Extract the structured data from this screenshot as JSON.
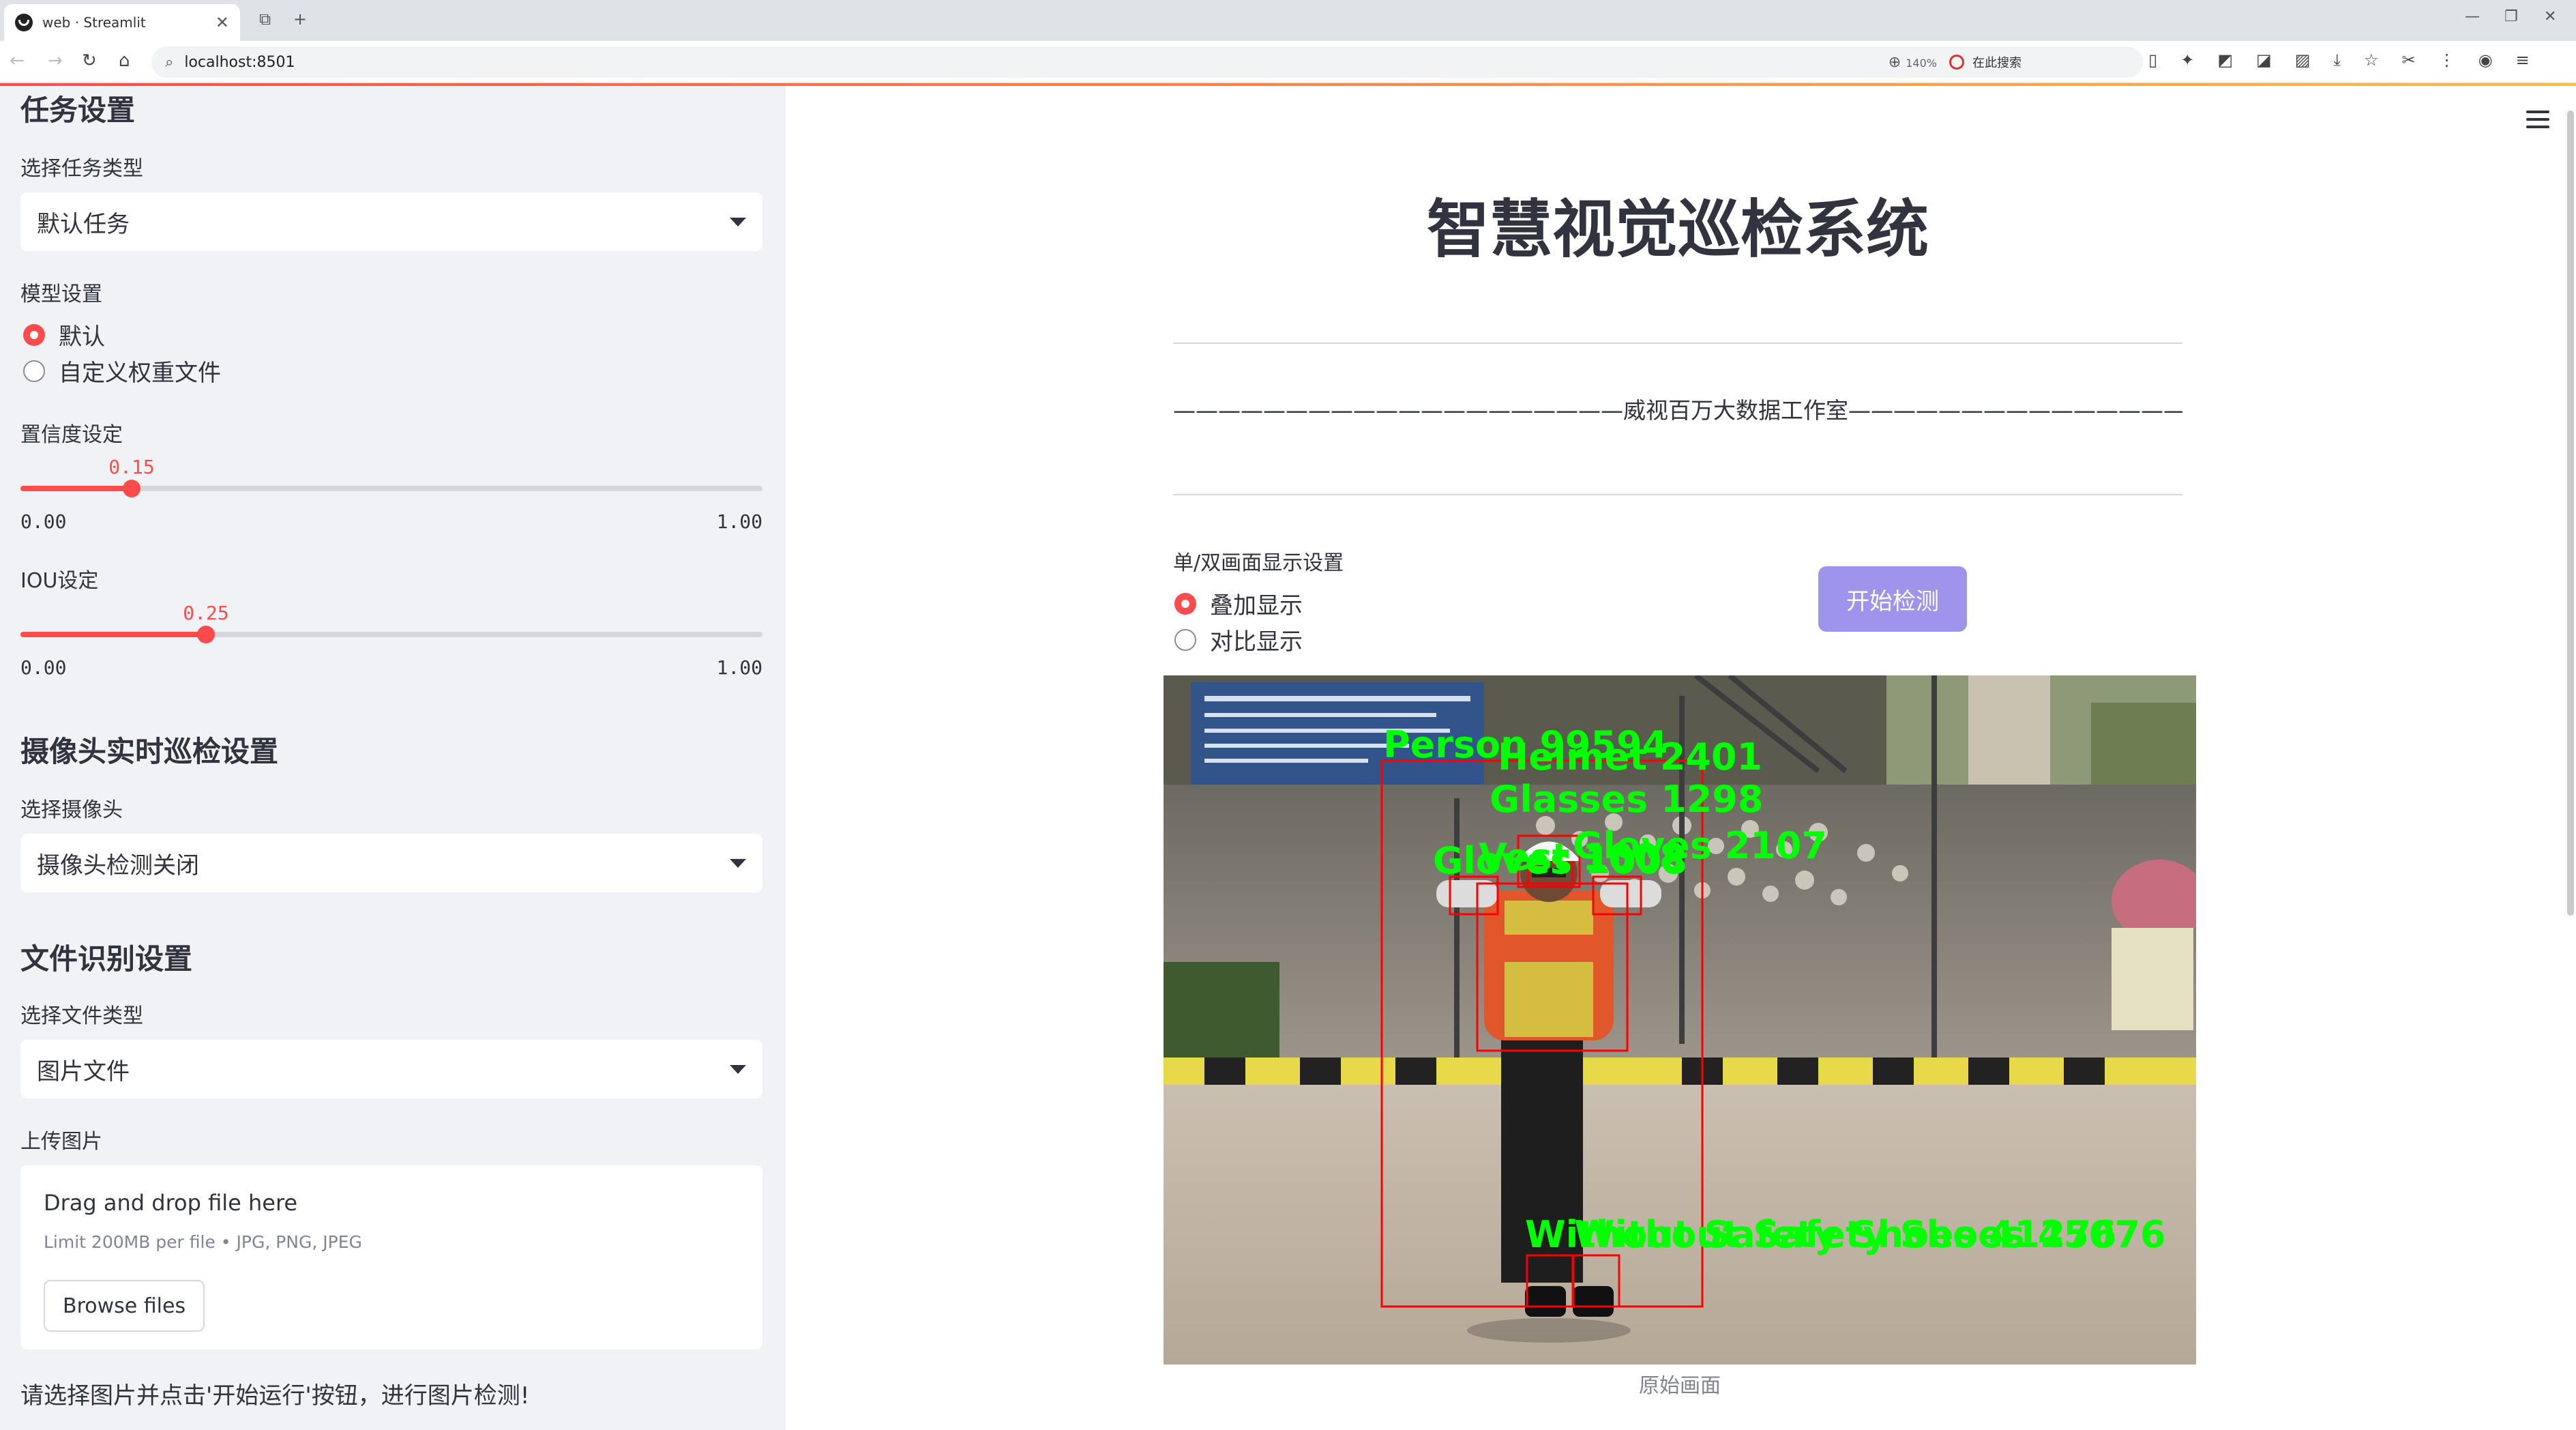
{
  "browser": {
    "tab_title": "web · Streamlit",
    "url": "localhost:8501",
    "zoom": "140%",
    "search_text": "在此搜索"
  },
  "sidebar": {
    "task_heading": "任务设置",
    "task_type_label": "选择任务类型",
    "task_type_value": "默认任务",
    "model_label": "模型设置",
    "model_options": [
      "默认",
      "自定义权重文件"
    ],
    "model_selected": "默认",
    "conf_label": "置信度设定",
    "conf_value": "0.15",
    "conf_min": "0.00",
    "conf_max": "1.00",
    "conf_fraction": 0.15,
    "iou_label": "IOU设定",
    "iou_value": "0.25",
    "iou_min": "0.00",
    "iou_max": "1.00",
    "iou_fraction": 0.25,
    "camera_heading": "摄像头实时巡检设置",
    "camera_label": "选择摄像头",
    "camera_value": "摄像头检测关闭",
    "file_heading": "文件识别设置",
    "file_type_label": "选择文件类型",
    "file_type_value": "图片文件",
    "upload_label": "上传图片",
    "upload_title": "Drag and drop file here",
    "upload_limit": "Limit 200MB per file • JPG, PNG, JPEG",
    "browse_label": "Browse files",
    "hint": "请选择图片并点击'开始运行'按钮，进行图片检测!"
  },
  "main": {
    "title": "智慧视觉巡检系统",
    "subtitle": "————————————————————威视百万大数据工作室————————————————————",
    "display_label": "单/双画面显示设置",
    "display_options": [
      "叠加显示",
      "对比显示"
    ],
    "display_selected": "叠加显示",
    "start_button": "开始检测",
    "image_caption": "原始画面",
    "detections": [
      "Person 99594",
      "Helmet 2401",
      "Glasses 1298",
      "Gloves 2107",
      "Vest 1008",
      "Gloves 1008",
      "Without Safety Shoes 41276",
      "Without Safety Shoes 45076"
    ]
  },
  "colors": {
    "accent": "#ff4b4b",
    "button": "#9f94ec",
    "sidebar_bg": "#f0f2f6",
    "detection_box": "#ff0000",
    "detection_text": "#00ff00"
  }
}
